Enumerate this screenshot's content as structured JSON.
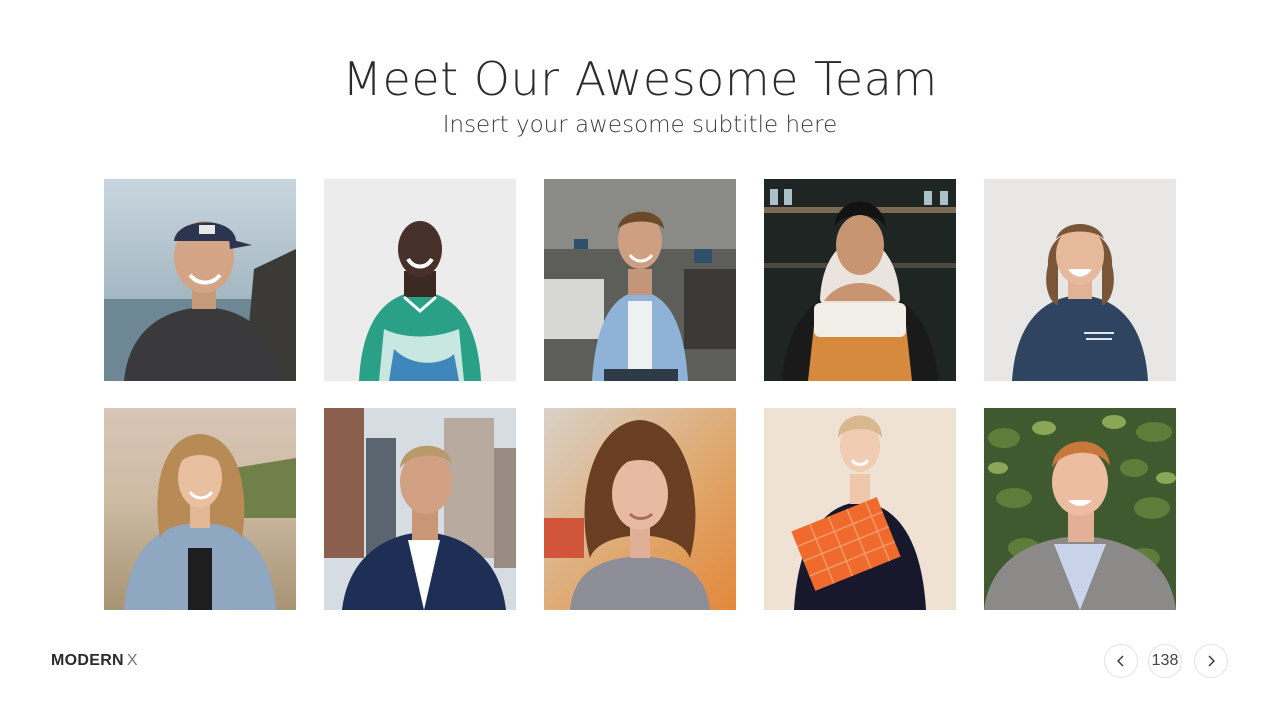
{
  "slide": {
    "title": "Meet Our Awesome Team",
    "subtitle": "Insert your awesome subtitle here"
  },
  "team_photos": [
    {
      "name": "man-in-cap",
      "icon": "portrait-man-cap"
    },
    {
      "name": "man-in-jersey",
      "icon": "portrait-man-jersey"
    },
    {
      "name": "man-in-office",
      "icon": "portrait-man-office"
    },
    {
      "name": "woman-in-hijab",
      "icon": "portrait-woman-hijab"
    },
    {
      "name": "woman-smiling",
      "icon": "portrait-woman-smiling"
    },
    {
      "name": "woman-in-denim",
      "icon": "portrait-woman-denim"
    },
    {
      "name": "man-in-suit",
      "icon": "portrait-man-suit"
    },
    {
      "name": "woman-curly-hair",
      "icon": "portrait-woman-curly"
    },
    {
      "name": "woman-with-folder",
      "icon": "portrait-woman-folder"
    },
    {
      "name": "man-with-plants",
      "icon": "portrait-man-plants"
    }
  ],
  "footer": {
    "brand_bold": "MODERN",
    "brand_light": "X",
    "page_number": "138",
    "prev_icon": "chevron-left-icon",
    "next_icon": "chevron-right-icon"
  }
}
